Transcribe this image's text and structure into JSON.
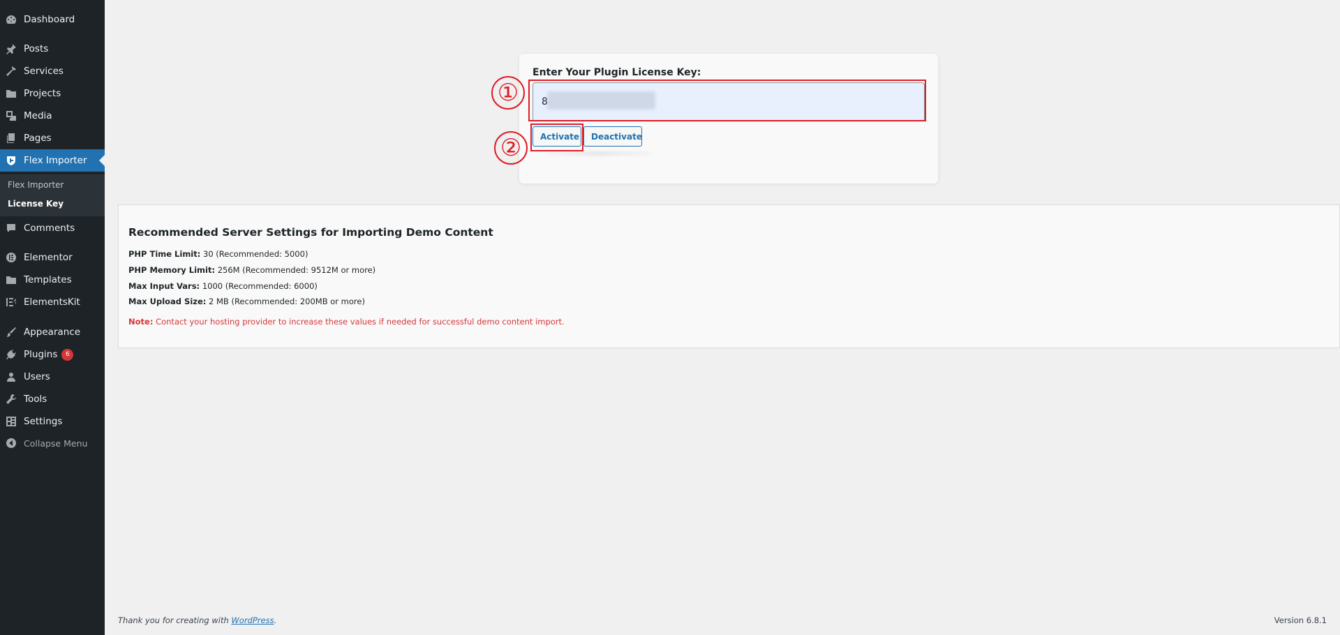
{
  "sidebar": {
    "items": [
      {
        "label": "Dashboard",
        "icon": "dashboard-icon"
      },
      {
        "label": "Posts",
        "icon": "pin-icon"
      },
      {
        "label": "Services",
        "icon": "hammer-icon"
      },
      {
        "label": "Projects",
        "icon": "folder-icon"
      },
      {
        "label": "Media",
        "icon": "media-icon"
      },
      {
        "label": "Pages",
        "icon": "pages-icon"
      },
      {
        "label": "Flex Importer",
        "icon": "shield-icon"
      },
      {
        "label": "Comments",
        "icon": "comment-icon"
      },
      {
        "label": "Elementor",
        "icon": "elementor-icon"
      },
      {
        "label": "Templates",
        "icon": "folder-icon"
      },
      {
        "label": "ElementsKit",
        "icon": "elementskit-icon"
      },
      {
        "label": "Appearance",
        "icon": "brush-icon"
      },
      {
        "label": "Plugins",
        "icon": "plug-icon",
        "badge": "6"
      },
      {
        "label": "Users",
        "icon": "user-icon"
      },
      {
        "label": "Tools",
        "icon": "wrench-icon"
      },
      {
        "label": "Settings",
        "icon": "settings-icon"
      }
    ],
    "submenu": [
      {
        "label": "Flex Importer"
      },
      {
        "label": "License Key"
      }
    ],
    "collapse_label": "Collapse Menu"
  },
  "license": {
    "label": "Enter Your Plugin License Key:",
    "value": "8",
    "activate_label": "Activate",
    "deactivate_label": "Deactivate"
  },
  "annotations": {
    "one": "①",
    "two": "②",
    "color": "#e01b24"
  },
  "settings": {
    "title": "Recommended Server Settings for Importing Demo Content",
    "rows": [
      {
        "label": "PHP Time Limit:",
        "value": "30 (Recommended: 5000)"
      },
      {
        "label": "PHP Memory Limit:",
        "value": "256M (Recommended: 9512M or more)"
      },
      {
        "label": "Max Input Vars:",
        "value": "1000 (Recommended: 6000)"
      },
      {
        "label": "Max Upload Size:",
        "value": "2 MB (Recommended: 200MB or more)"
      }
    ],
    "note_label": "Note:",
    "note_text": "Contact your hosting provider to increase these values if needed for successful demo content import."
  },
  "footer": {
    "thanks_prefix": "Thank you for creating with",
    "wordpress_link": "WordPress",
    "thanks_suffix": ".",
    "version": "Version 6.8.1"
  },
  "colors": {
    "sidebar_bg": "#1d2327",
    "accent": "#2271b1",
    "badge": "#d63638",
    "annotation": "#e01b24"
  }
}
